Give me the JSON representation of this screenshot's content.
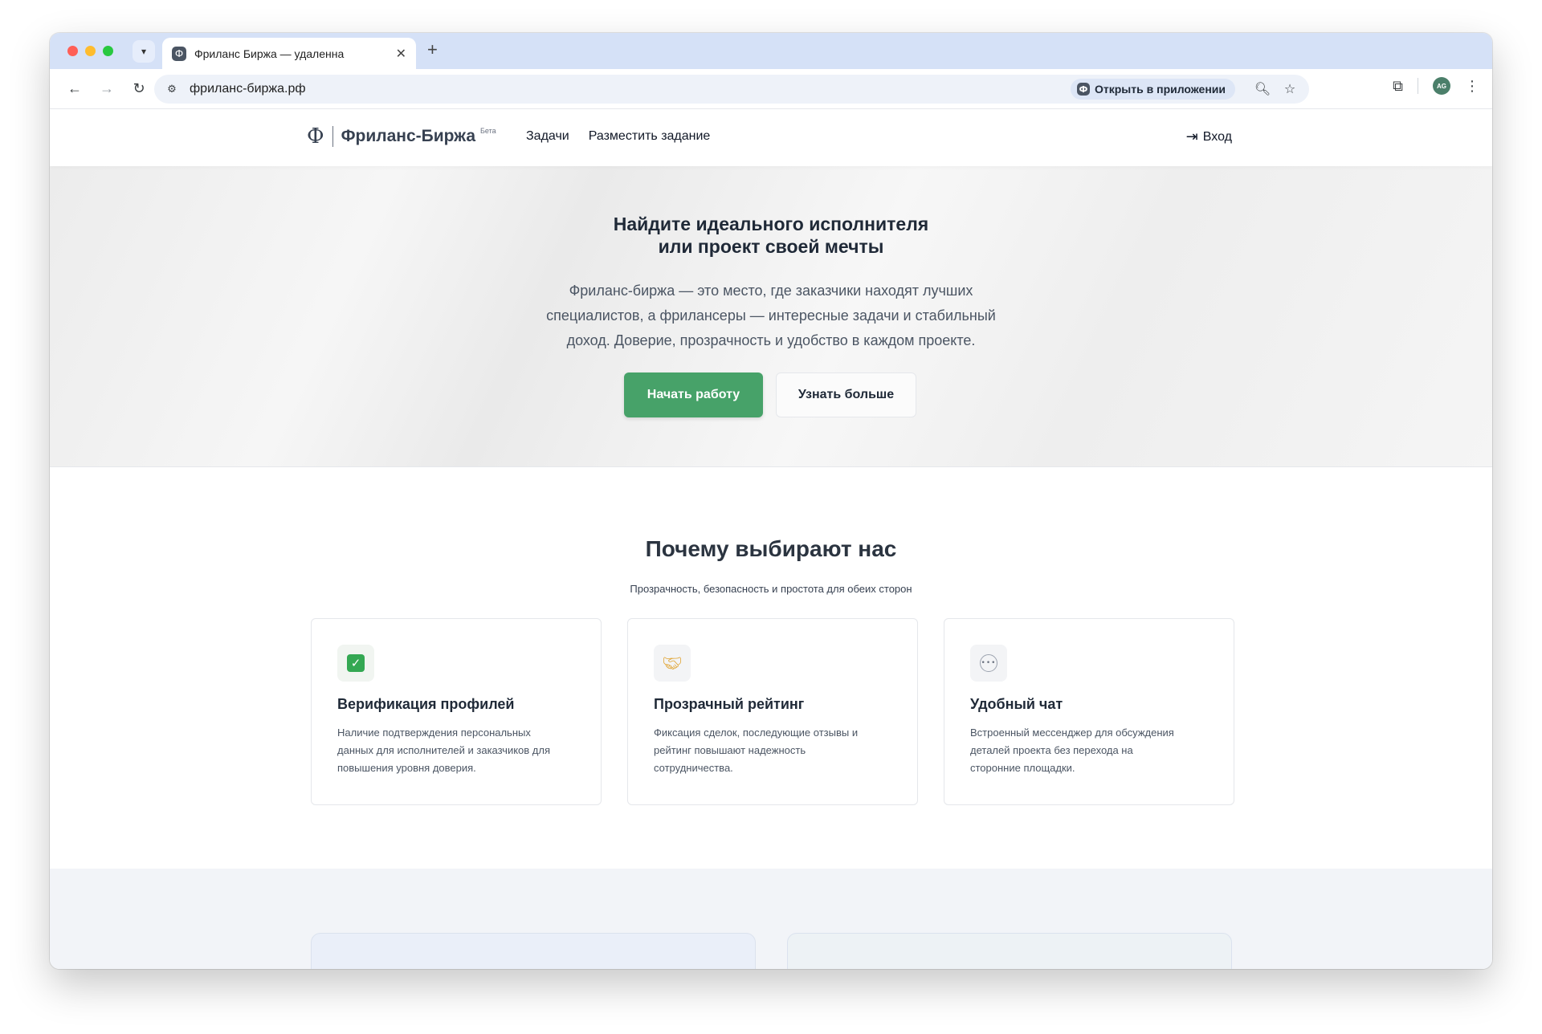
{
  "browser": {
    "tab_title": "Фриланс Биржа — удаленна",
    "url": "фриланс-биржа.рф",
    "open_in_app": "Открыть в приложении",
    "avatar_initials": "AG"
  },
  "site": {
    "brand_glyph": "Ф",
    "brand_name": "Фриланс-Биржа",
    "brand_beta": "Бета",
    "nav": [
      "Задачи",
      "Разместить задание"
    ],
    "login": "Вход"
  },
  "hero": {
    "title_lines": [
      "Найдите идеального исполнителя",
      "или проект своей мечты"
    ],
    "subtitle_lines": [
      "Фриланс-биржа — это место, где заказчики находят лучших",
      "специалистов, а фрилансеры — интересные задачи и стабильный",
      "доход. Доверие, прозрачность и удобство в каждом проекте."
    ],
    "primary_button": "Начать работу",
    "secondary_button": "Узнать больше"
  },
  "why": {
    "title": "Почему выбирают нас",
    "subtitle": "Прозрачность, безопасность и простота для обеих сторон",
    "cards": [
      {
        "icon": "check-icon",
        "title": "Верификация профилей",
        "text_lines": [
          "Наличие подтверждения персональных",
          "данных для исполнителей и заказчиков для",
          "повышения уровня доверия."
        ]
      },
      {
        "icon": "handshake-icon",
        "title": "Прозрачный рейтинг",
        "text_lines": [
          "Фиксация сделок, последующие отзывы и",
          "рейтинг повышают надежность",
          "сотрудничества."
        ]
      },
      {
        "icon": "chat-icon",
        "title": "Удобный чат",
        "text_lines": [
          "Встроенный мессенджер для обсуждения",
          "деталей проекта без перехода на",
          "сторонние площадки."
        ]
      }
    ]
  },
  "colors": {
    "primary": "#47a269",
    "tabstrip": "#d5e1f7"
  }
}
